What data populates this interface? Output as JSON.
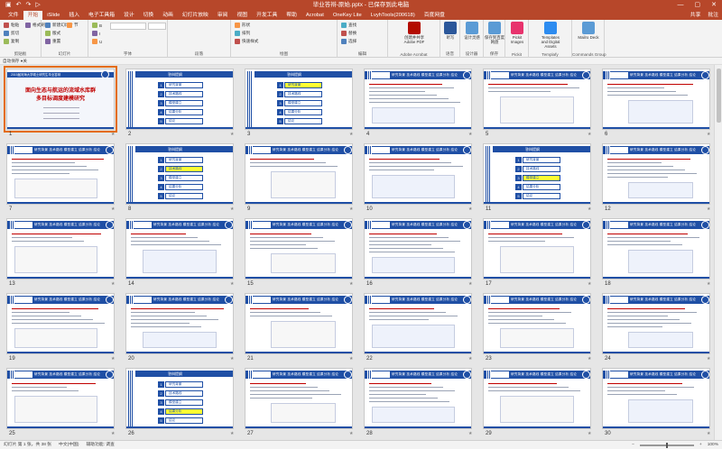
{
  "window": {
    "title": "毕业答辩-原始.pptx - 已保存到此电脑",
    "quick_access": [
      "save-icon",
      "undo-icon",
      "redo-icon",
      "present-icon"
    ],
    "controls": [
      "minimize",
      "restore",
      "close"
    ]
  },
  "tabs": [
    "文件",
    "开始",
    "iSlide",
    "插入",
    "电子工具箱",
    "设计",
    "切换",
    "动画",
    "幻灯片放映",
    "审阅",
    "视图",
    "开发工具",
    "帮助",
    "Acrobat",
    "OneKey Lite",
    "LvyhTools(200618)",
    "百度网盘"
  ],
  "active_tab": "开始",
  "tab_right": [
    "共享",
    "批注"
  ],
  "ribbon": {
    "groups": [
      {
        "label": "剪贴板",
        "items": [
          "粘贴",
          "剪切",
          "复制",
          "格式刷"
        ]
      },
      {
        "label": "幻灯片",
        "items": [
          "新建幻灯片",
          "版式",
          "重置",
          "节"
        ]
      },
      {
        "label": "字体",
        "items": [
          "B",
          "I",
          "U",
          "S"
        ]
      },
      {
        "label": "段落",
        "items": []
      },
      {
        "label": "绘图",
        "items": [
          "形状",
          "排列",
          "快速样式"
        ]
      },
      {
        "label": "编辑",
        "items": [
          "查找",
          "替换",
          "选择"
        ]
      },
      {
        "label": "Adobe Acrobat",
        "items": [
          "创建并共享 Adobe PDF"
        ]
      },
      {
        "label": "语音",
        "items": [
          "听写"
        ]
      },
      {
        "label": "设计器",
        "items": [
          "设计灵感"
        ]
      },
      {
        "label": "保存",
        "items": [
          "保存到百度网盘"
        ]
      },
      {
        "label": "Pickit",
        "items": [
          "Pickit Images"
        ]
      },
      {
        "label": "Templafy",
        "items": [
          "Templates and Digital Assets"
        ]
      },
      {
        "label": "Commands Group",
        "items": [
          "Mailro Deck"
        ]
      }
    ]
  },
  "option_row": "自动保存 ●关",
  "slides": [
    {
      "n": "1",
      "type": "title",
      "title": [
        "面向生态与航运的流域水库群",
        "多目标调度建模研究"
      ],
      "header": "2019届河海大学硕士研究生毕业答辩"
    },
    {
      "n": "2",
      "type": "menu",
      "hl": -1
    },
    {
      "n": "3",
      "type": "menu",
      "hl": 0
    },
    {
      "n": "4",
      "type": "content",
      "nav": "研究背景 技术路线 模型建立 结果分析 结论"
    },
    {
      "n": "5",
      "type": "content",
      "nav": "研究背景 技术路线 模型建立 结果分析 结论"
    },
    {
      "n": "6",
      "type": "content",
      "nav": "研究背景 技术路线 模型建立 结果分析 结论"
    },
    {
      "n": "7",
      "type": "content",
      "nav": "研究背景 技术路线 模型建立 结果分析 结论"
    },
    {
      "n": "8",
      "type": "menu",
      "hl": 1
    },
    {
      "n": "9",
      "type": "content",
      "nav": "研究背景 技术路线 模型建立 结果分析 结论"
    },
    {
      "n": "10",
      "type": "content",
      "nav": "研究背景 技术路线 模型建立 结果分析 结论"
    },
    {
      "n": "11",
      "type": "menu",
      "hl": 2
    },
    {
      "n": "12",
      "type": "content",
      "nav": "研究背景 技术路线 模型建立 结果分析 结论"
    },
    {
      "n": "13",
      "type": "content",
      "nav": "研究背景 技术路线 模型建立 结果分析 结论"
    },
    {
      "n": "14",
      "type": "content",
      "nav": "研究背景 技术路线 模型建立 结果分析 结论"
    },
    {
      "n": "15",
      "type": "content",
      "nav": "研究背景 技术路线 模型建立 结果分析 结论"
    },
    {
      "n": "16",
      "type": "content",
      "nav": "研究背景 技术路线 模型建立 结果分析 结论"
    },
    {
      "n": "17",
      "type": "content",
      "nav": "研究背景 技术路线 模型建立 结果分析 结论"
    },
    {
      "n": "18",
      "type": "content",
      "nav": "研究背景 技术路线 模型建立 结果分析 结论"
    },
    {
      "n": "19",
      "type": "content",
      "nav": "研究背景 技术路线 模型建立 结果分析 结论"
    },
    {
      "n": "20",
      "type": "content",
      "nav": "研究背景 技术路线 模型建立 结果分析 结论"
    },
    {
      "n": "21",
      "type": "content",
      "nav": "研究背景 技术路线 模型建立 结果分析 结论"
    },
    {
      "n": "22",
      "type": "content",
      "nav": "研究背景 技术路线 模型建立 结果分析 结论"
    },
    {
      "n": "23",
      "type": "content",
      "nav": "研究背景 技术路线 模型建立 结果分析 结论"
    },
    {
      "n": "24",
      "type": "content",
      "nav": "研究背景 技术路线 模型建立 结果分析 结论"
    },
    {
      "n": "25",
      "type": "content",
      "nav": "研究背景 技术路线 模型建立 结果分析 结论"
    },
    {
      "n": "26",
      "type": "menu",
      "hl": 3
    },
    {
      "n": "27",
      "type": "content",
      "nav": "研究背景 技术路线 模型建立 结果分析 结论"
    },
    {
      "n": "28",
      "type": "content",
      "nav": "研究背景 技术路线 模型建立 结果分析 结论"
    },
    {
      "n": "29",
      "type": "content",
      "nav": "研究背景 技术路线 模型建立 结果分析 结论"
    },
    {
      "n": "30",
      "type": "content",
      "nav": "研究背景 技术路线 模型建立 结果分析 结论"
    }
  ],
  "menu_items": [
    "研究背景",
    "技术路线",
    "模型建立",
    "结果分析",
    "结论"
  ],
  "menu_header": "答辩提纲",
  "status": {
    "left": [
      "幻灯片 第 1 张，共 38 张",
      "中文(中国)",
      "辅助功能: 调查"
    ],
    "zoom": "100%"
  },
  "colors": {
    "accent": "#b7472a",
    "slide_blue": "#1f4fa5",
    "highlight": "#ffff33"
  }
}
